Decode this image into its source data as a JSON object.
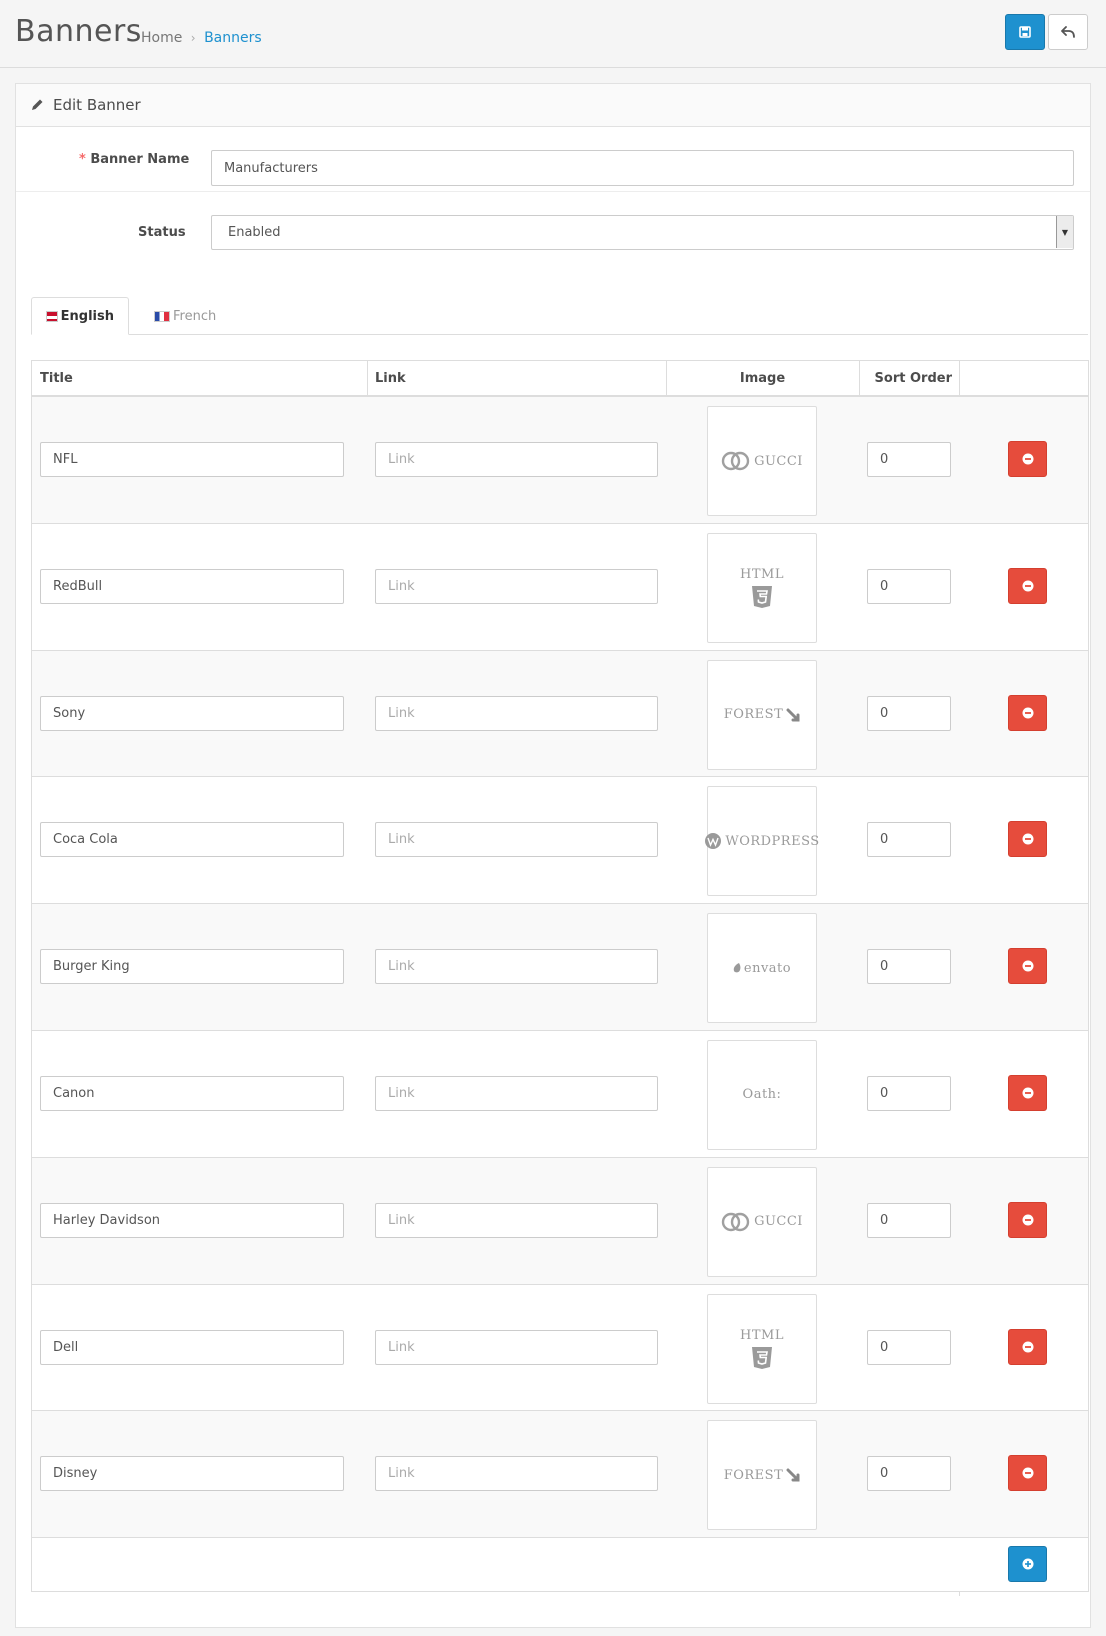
{
  "header": {
    "title": "Banners",
    "breadcrumb": [
      {
        "label": "Home"
      },
      {
        "label": "Banners"
      }
    ],
    "breadcrumb_separator": "›"
  },
  "panel": {
    "title": "Edit Banner"
  },
  "form": {
    "required_marker": "*",
    "banner_name_label": "Banner Name",
    "banner_name_value": "Manufacturers",
    "status_label": "Status",
    "status_value": "Enabled"
  },
  "tabs": [
    {
      "label": "English",
      "active": true
    },
    {
      "label": "French",
      "active": false
    }
  ],
  "table": {
    "headers": [
      "Title",
      "Link",
      "Image",
      "Sort Order"
    ],
    "link_placeholder": "Link",
    "rows": [
      {
        "title": "NFL",
        "image": "gucci-logo",
        "image_text": "GUCCI",
        "sort": "0"
      },
      {
        "title": "RedBull",
        "image": "html5-logo",
        "image_text": "HTML",
        "sort": "0"
      },
      {
        "title": "Sony",
        "image": "themeforest-logo",
        "image_text": "FOREST",
        "sort": "0"
      },
      {
        "title": "Coca Cola",
        "image": "wordpress-logo",
        "image_text": "WORDPRESS",
        "sort": "0"
      },
      {
        "title": "Burger King",
        "image": "envato-logo",
        "image_text": "envato",
        "sort": "0"
      },
      {
        "title": "Canon",
        "image": "oath-logo",
        "image_text": "Oath:",
        "sort": "0"
      },
      {
        "title": "Harley Davidson",
        "image": "gucci-logo",
        "image_text": "GUCCI",
        "sort": "0"
      },
      {
        "title": "Dell",
        "image": "html5-logo",
        "image_text": "HTML",
        "sort": "0"
      },
      {
        "title": "Disney",
        "image": "themeforest-logo",
        "image_text": "FOREST",
        "sort": "0"
      }
    ]
  },
  "colors": {
    "primary": "#1e91cf",
    "danger": "#e64c3c",
    "required": "#f56b6b"
  }
}
